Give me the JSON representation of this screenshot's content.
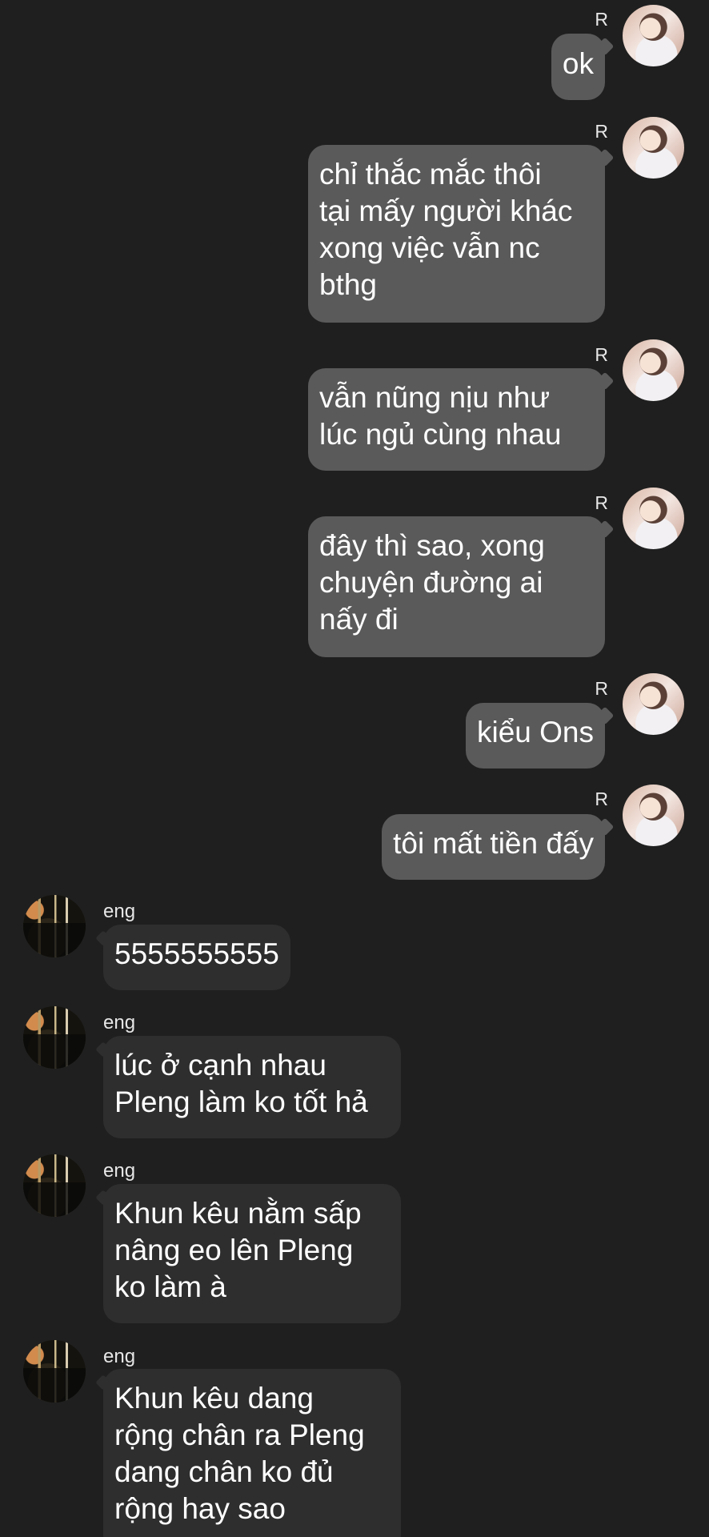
{
  "conversation": {
    "messages": [
      {
        "sender": "R",
        "side": "right",
        "text": "ok"
      },
      {
        "sender": "R",
        "side": "right",
        "text": "chỉ thắc mắc thôi\ntại mấy người khác\nxong việc vẫn nc\nbthg"
      },
      {
        "sender": "R",
        "side": "right",
        "text": "vẫn nũng nịu như\nlúc ngủ cùng nhau"
      },
      {
        "sender": "R",
        "side": "right",
        "text": "đây thì sao, xong\nchuyện đường ai\nnấy đi"
      },
      {
        "sender": "R",
        "side": "right",
        "text": "kiểu Ons"
      },
      {
        "sender": "R",
        "side": "right",
        "text": "tôi mất tiền đấy"
      },
      {
        "sender": "eng",
        "side": "left",
        "text": "5555555555"
      },
      {
        "sender": "eng",
        "side": "left",
        "text": "lúc ở cạnh nhau\nPleng làm ko tốt hả"
      },
      {
        "sender": "eng",
        "side": "left",
        "text": "Khun kêu nằm sấp\nnâng eo lên Pleng\nko làm à"
      },
      {
        "sender": "eng",
        "side": "left",
        "text": "Khun kêu dang\nrộng chân ra Pleng\ndang chân ko đủ\nrộng hay sao"
      }
    ]
  },
  "colors": {
    "background": "#1f1f1f",
    "outgoing_bubble": "#5a5a5a",
    "incoming_bubble": "#2e2e2e",
    "text": "#ffffff"
  }
}
